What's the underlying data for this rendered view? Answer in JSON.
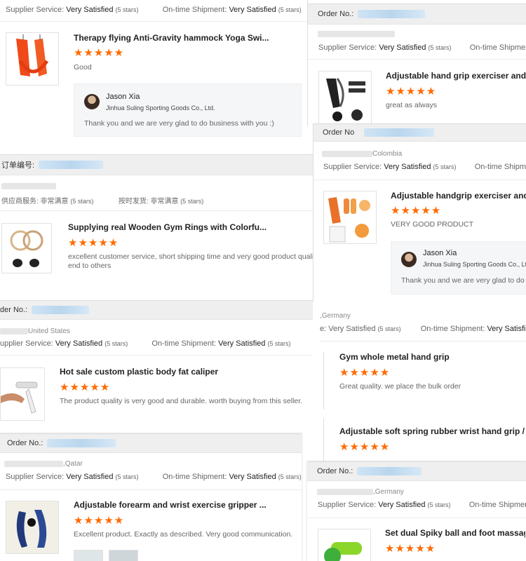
{
  "labels": {
    "supplier_service": "Supplier Service:",
    "ontime_shipment": "On-time Shipment:",
    "very_satisfied": "Very Satisfied",
    "five_stars": "(5 stars)",
    "order_no": "Order No.:",
    "order_no_alt": "Order No",
    "cn_order": "订单编号:",
    "cn_supplier": "供应商服务: 非常满意",
    "cn_ontime": "按时发货: 非常满意",
    "stars": "★★★★★"
  },
  "reviews": [
    {
      "title": "Therapy flying Anti-Gravity hammock Yoga Swi...",
      "comment": "Good",
      "reply": {
        "name": "Jason Xia",
        "company": "Jinhua Suling Sporting Goods Co., Ltd.",
        "text": "Thank you and we are very glad to do business with you :)"
      }
    },
    {
      "title": "Supplying real Wooden Gym Rings with Colorfu...",
      "comment_1": "excellent customer service, short shipping time and very good product qualit",
      "comment_2": "end to others"
    },
    {
      "country": "United States",
      "supplier_prefix": "upplier Service:",
      "order_prefix": "der No.:",
      "title": "Hot sale custom plastic body fat caliper",
      "comment": "The product quality is very good and durable. worth buying from this seller."
    },
    {
      "country": ",Qatar",
      "title": "Adjustable forearm and wrist exercise gripper ...",
      "comment": "Excellent product. Exactly as described. Very good communication."
    },
    {
      "title": "Adjustable hand grip exerciser and fing",
      "comment": "great as always"
    },
    {
      "country": "Colombia",
      "title": "Adjustable handgrip exerciser and fin",
      "comment": "VERY GOOD PRODUCT",
      "ontime_cut": "On-time Shipmen",
      "reply": {
        "name": "Jason Xia",
        "company": "Jinhua Suling Sporting Goods Co., Ltd.",
        "text": "Thank you and we are very glad to do bu"
      }
    },
    {
      "country": ",Germany",
      "supplier_prefix": "e: Very Satisfied",
      "title": "Gym whole metal hand grip",
      "comment": "Great quality. we place the bulk order"
    },
    {
      "title": "Adjustable soft spring rubber wrist hand grip / ..."
    },
    {
      "country": ",Germany",
      "ontime_cut": "On-time Shipment:",
      "title": "Set dual Spiky ball and foot massage r"
    }
  ],
  "colors": {
    "star": "#ff6a00",
    "bar": "#efefef",
    "blur": "#c4ddf1"
  }
}
